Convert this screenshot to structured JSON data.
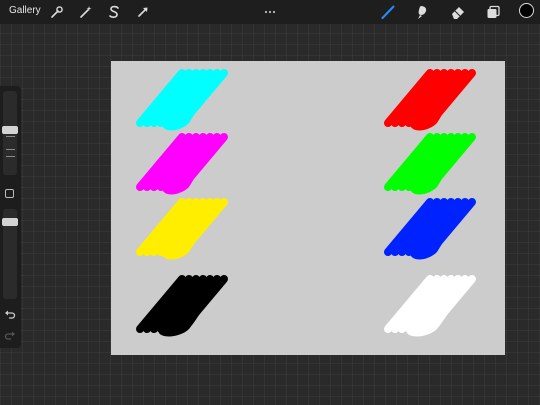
{
  "topbar": {
    "gallery_label": "Gallery",
    "left_tools": [
      "wrench-icon",
      "magic-wand-icon",
      "s-selection-icon",
      "arrow-transform-icon"
    ],
    "right_tools": [
      "brush-icon",
      "smudge-icon",
      "eraser-icon",
      "layers-icon"
    ],
    "active_tool": "brush-icon",
    "accent_color": "#1e90ff",
    "current_color": "#000000"
  },
  "sidebar": {
    "brush_size_level": 0.25,
    "opacity_level": 0.05
  },
  "canvas": {
    "background": "#cccccc",
    "swatches_left": [
      {
        "name": "cyan",
        "color": "#00ffff"
      },
      {
        "name": "magenta",
        "color": "#ff00ff"
      },
      {
        "name": "yellow",
        "color": "#ffee00"
      },
      {
        "name": "black",
        "color": "#000000"
      }
    ],
    "swatches_right": [
      {
        "name": "red",
        "color": "#ff0000"
      },
      {
        "name": "green",
        "color": "#00ff00"
      },
      {
        "name": "blue",
        "color": "#0022ff"
      },
      {
        "name": "white",
        "color": "#ffffff"
      }
    ]
  }
}
